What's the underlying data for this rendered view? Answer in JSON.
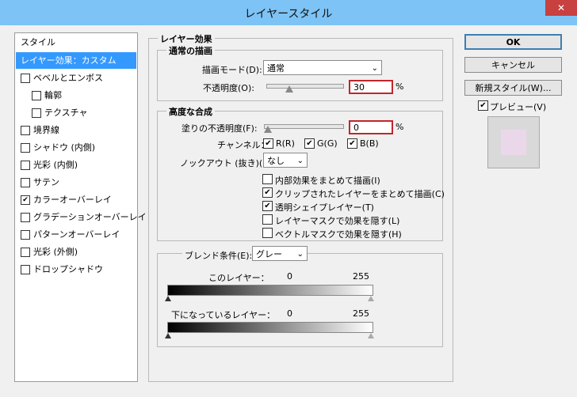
{
  "window": {
    "title": "レイヤースタイル",
    "close_glyph": "✕"
  },
  "styles_list": {
    "header": "スタイル",
    "items": [
      {
        "label": "レイヤー効果：カスタム",
        "checkbox": false,
        "checked": false,
        "selected": true
      },
      {
        "label": "ベベルとエンボス",
        "checkbox": true,
        "checked": false
      },
      {
        "label": "輪郭",
        "checkbox": true,
        "checked": false,
        "indent": true
      },
      {
        "label": "テクスチャ",
        "checkbox": true,
        "checked": false,
        "indent": true
      },
      {
        "label": "境界線",
        "checkbox": true,
        "checked": false
      },
      {
        "label": "シャドウ (内側)",
        "checkbox": true,
        "checked": false
      },
      {
        "label": "光彩 (内側)",
        "checkbox": true,
        "checked": false
      },
      {
        "label": "サテン",
        "checkbox": true,
        "checked": false
      },
      {
        "label": "カラーオーバーレイ",
        "checkbox": true,
        "checked": true
      },
      {
        "label": "グラデーションオーバーレイ",
        "checkbox": true,
        "checked": false
      },
      {
        "label": "パターンオーバーレイ",
        "checkbox": true,
        "checked": false
      },
      {
        "label": "光彩 (外側)",
        "checkbox": true,
        "checked": false
      },
      {
        "label": "ドロップシャドウ",
        "checkbox": true,
        "checked": false
      }
    ]
  },
  "layer_effects": {
    "title": "レイヤー効果",
    "normal_blend": {
      "title": "通常の描画",
      "blend_mode_label": "描画モード(D):",
      "blend_mode_value": "通常",
      "opacity_label": "不透明度(O):",
      "opacity_value": "30",
      "opacity_level": 0.3,
      "percent": "%"
    },
    "advanced_blend": {
      "title": "高度な合成",
      "fill_opacity_label": "塗りの不透明度(F):",
      "fill_opacity_value": "0",
      "fill_opacity_level": 0.0,
      "percent": "%",
      "channels_label": "チャンネル：",
      "channels": [
        {
          "label": "R(R)",
          "checked": true
        },
        {
          "label": "G(G)",
          "checked": true
        },
        {
          "label": "B(B)",
          "checked": true
        }
      ],
      "knockout_label": "ノックアウト (抜き)(K):",
      "knockout_value": "なし",
      "options": [
        {
          "label": "内部効果をまとめて描画(I)",
          "checked": false
        },
        {
          "label": "クリップされたレイヤーをまとめて描画(C)",
          "checked": true
        },
        {
          "label": "透明シェイプレイヤー(T)",
          "checked": true
        },
        {
          "label": "レイヤーマスクで効果を隠す(L)",
          "checked": false
        },
        {
          "label": "ベクトルマスクで効果を隠す(H)",
          "checked": false
        }
      ]
    },
    "blend_if": {
      "label": "ブレンド条件(E):",
      "value": "グレー",
      "this_layer_label": "このレイヤー：",
      "this_layer_min": "0",
      "this_layer_max": "255",
      "underlying_label": "下になっているレイヤー：",
      "underlying_min": "0",
      "underlying_max": "255"
    }
  },
  "buttons": {
    "ok": "OK",
    "cancel": "キャンセル",
    "new_style": "新規スタイル(W)...",
    "preview_label": "プレビュー(V)",
    "preview_checked": true
  },
  "preview_color": "#ead8ea"
}
